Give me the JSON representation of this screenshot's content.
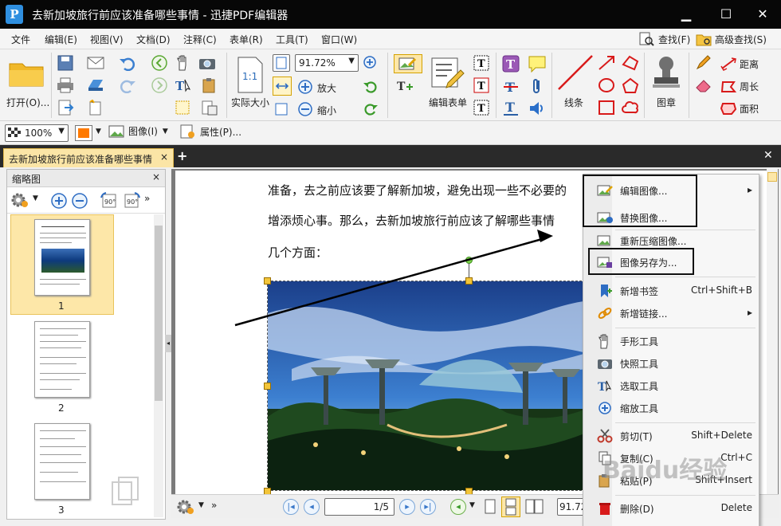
{
  "window": {
    "title": "去新加坡旅行前应该准备哪些事情 - 迅捷PDF编辑器",
    "logo": "P",
    "min": "▁",
    "max": "☐",
    "close": "✕"
  },
  "menu": {
    "items": [
      "文件",
      "编辑(E)",
      "视图(V)",
      "文档(D)",
      "注释(C)",
      "表单(R)",
      "工具(T)",
      "窗口(W)"
    ],
    "find": "查找(F)",
    "adv_find": "高级查找(S)"
  },
  "ribbon": {
    "open": "打开(O)...",
    "zoom_value": "91.72%",
    "actual_size": "实际大小",
    "actual_size_icon": "1:1",
    "zoom_in": "放大",
    "zoom_out": "缩小",
    "edit_form": "编辑表单",
    "line_tool": "线条",
    "stamp": "图章",
    "distance": "距离",
    "perimeter": "周长",
    "area": "面积"
  },
  "subbar": {
    "opacity": "100%",
    "image_menu": "图像(I)",
    "properties": "属性(P)..."
  },
  "tab": {
    "title": "去新加坡旅行前应该准备哪些事情",
    "add": "+",
    "close": "✕"
  },
  "thumbnails": {
    "title": "缩略图",
    "close": "×",
    "pages": [
      "1",
      "2",
      "3"
    ]
  },
  "document": {
    "lines": [
      "准备，去之前应该要了解新加坡，避免出现一些不必要的",
      "增添烦心事。那么，去新加坡旅行前应该了解哪些事情",
      "几个方面："
    ]
  },
  "statusbar": {
    "page_value": "1/5",
    "zoom": "91.72"
  },
  "context_menu": [
    {
      "label": "编辑图像...",
      "shortcut": "▸",
      "icon": "edit-image-icon"
    },
    {
      "label": "替换图像...",
      "shortcut": "",
      "icon": "replace-image-icon"
    },
    {
      "label": "重新压缩图像...",
      "shortcut": "",
      "icon": "recompress-image-icon"
    },
    {
      "label": "图像另存为...",
      "shortcut": "",
      "icon": "save-image-icon"
    },
    {
      "label": "新增书签",
      "shortcut": "Ctrl+Shift+B",
      "icon": "bookmark-icon"
    },
    {
      "label": "新增链接...",
      "shortcut": "▸",
      "icon": "link-icon"
    },
    {
      "label": "手形工具",
      "shortcut": "",
      "icon": "hand-icon"
    },
    {
      "label": "快照工具",
      "shortcut": "",
      "icon": "camera-icon"
    },
    {
      "label": "选取工具",
      "shortcut": "",
      "icon": "select-text-icon"
    },
    {
      "label": "缩放工具",
      "shortcut": "",
      "icon": "zoom-icon"
    },
    {
      "label": "剪切(T)",
      "shortcut": "Shift+Delete",
      "icon": "scissors-icon"
    },
    {
      "label": "复制(C)",
      "shortcut": "Ctrl+C",
      "icon": "copy-icon"
    },
    {
      "label": "粘贴(P)",
      "shortcut": "Shift+Insert",
      "icon": "paste-icon"
    },
    {
      "label": "删除(D)",
      "shortcut": "Delete",
      "icon": "delete-icon"
    }
  ],
  "watermark": "Baidu经验"
}
